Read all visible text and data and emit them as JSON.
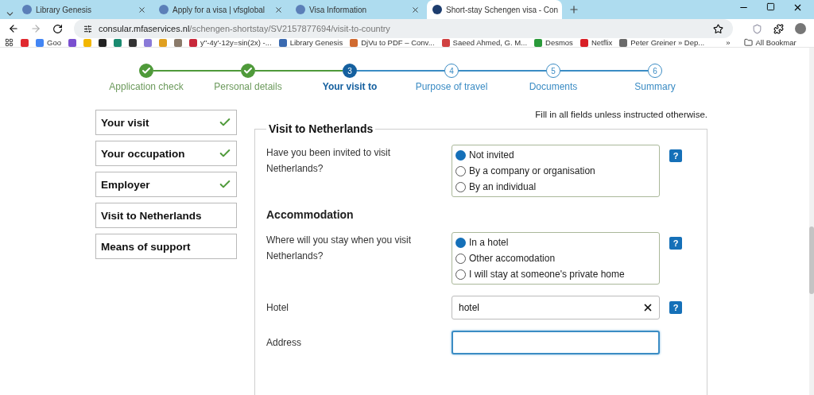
{
  "browser": {
    "tabs": [
      {
        "title": "Library Genesis",
        "selected": false
      },
      {
        "title": "Apply for a visa | vfsglobal",
        "selected": false
      },
      {
        "title": "Visa Information",
        "selected": false
      },
      {
        "title": "Short-stay Schengen visa - Con",
        "selected": true
      }
    ],
    "url": {
      "domain": "consular.mfaservices.nl",
      "path": "/schengen-shortstay/SV2157877694/visit-to-country"
    },
    "bookmarks": [
      {
        "color": "#e0282e"
      },
      {
        "label": "Goo",
        "color": "#4285f4"
      },
      {
        "color": "#7a4fd0"
      },
      {
        "color": "#f2b600"
      },
      {
        "color": "#222222"
      },
      {
        "color": "#1a8a70"
      },
      {
        "color": "#333333"
      },
      {
        "color": "#8a7ad8"
      },
      {
        "color": "#e0a020"
      },
      {
        "color": "#8a7a6a"
      },
      {
        "label": "y''-4y'-12y=sin(2x) -...",
        "color": "#c8283a"
      },
      {
        "label": "Library Genesis",
        "color": "#3a6ab0"
      },
      {
        "label": "DjVu to PDF – Conv...",
        "color": "#d06a30"
      },
      {
        "label": "Saeed Ahmed, G. M...",
        "color": "#d04040"
      },
      {
        "label": "Desmos",
        "color": "#2a9a3a"
      },
      {
        "label": "Netflix",
        "color": "#d81f26"
      },
      {
        "label": "Peter Greiner » Dep...",
        "color": "#6a6a6a"
      }
    ],
    "more": "»",
    "all_bookmarks": "All Bookmar"
  },
  "steps": [
    {
      "label": "Application check",
      "completed": true,
      "selected": false
    },
    {
      "label": "Personal details",
      "completed": true,
      "selected": false
    },
    {
      "number": "3",
      "label": "Your visit to",
      "completed": false,
      "selected": true
    },
    {
      "number": "4",
      "label": "Purpose of travel",
      "completed": false,
      "selected": false
    },
    {
      "number": "5",
      "label": "Documents",
      "completed": false,
      "selected": false
    },
    {
      "number": "6",
      "label": "Summary",
      "completed": false,
      "selected": false
    }
  ],
  "sidebar": [
    {
      "label": "Your visit",
      "done": true
    },
    {
      "label": "Your occupation",
      "done": true
    },
    {
      "label": "Employer",
      "done": true
    },
    {
      "label": "Visit to Netherlands",
      "done": false
    },
    {
      "label": "Means of support",
      "done": false
    }
  ],
  "form": {
    "note": "Fill in all fields unless instructed otherwise.",
    "title": "Visit to Netherlands",
    "items": [
      {
        "kind": "radio",
        "question": "Have you been invited to visit Netherlands?",
        "help": "?",
        "options": [
          {
            "label": "Not invited",
            "selected": true
          },
          {
            "label": "By a company or organisation",
            "selected": false
          },
          {
            "label": "By an individual",
            "selected": false
          }
        ]
      },
      {
        "kind": "heading",
        "text": "Accommodation"
      },
      {
        "kind": "radio",
        "question": "Where will you stay when you visit Netherlands?",
        "help": "?",
        "options": [
          {
            "label": "In a hotel",
            "selected": true
          },
          {
            "label": "Other accomodation",
            "selected": false
          },
          {
            "label": "I will stay at someone's private home",
            "selected": false
          }
        ]
      },
      {
        "kind": "text",
        "question": "Hotel",
        "value": "hotel",
        "clearable": true,
        "focused": false,
        "help": "?"
      },
      {
        "kind": "text",
        "question": "Address",
        "value": "",
        "focused": true
      }
    ]
  }
}
